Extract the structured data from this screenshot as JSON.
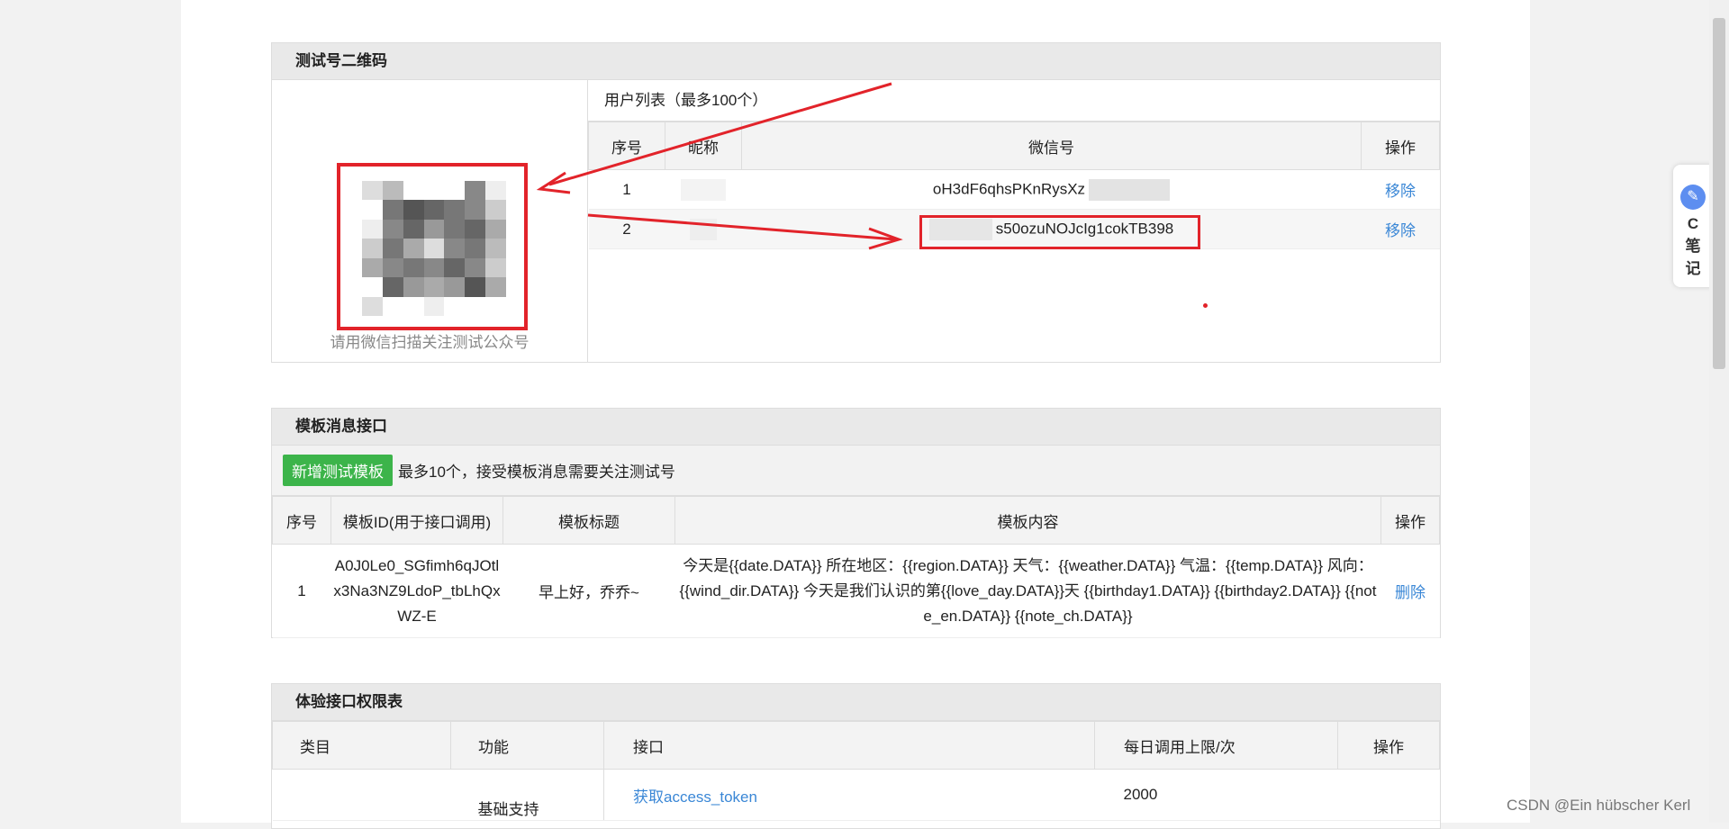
{
  "qr_panel": {
    "title": "测试号二维码",
    "caption": "请用微信扫描关注测试公众号",
    "users_title": "用户列表（最多100个）",
    "columns": [
      "序号",
      "昵称",
      "微信号",
      "操作"
    ],
    "rows": [
      {
        "index": "1",
        "openid_visible": "oH3dF6qhsPKnRysXz",
        "action": "移除"
      },
      {
        "index": "2",
        "openid_visible": "s50ozuNOJcIg1cokTB398",
        "action": "移除"
      }
    ]
  },
  "template_panel": {
    "title": "模板消息接口",
    "add_button": "新增测试模板",
    "hint": "最多10个，接受模板消息需要关注测试号",
    "columns": [
      "序号",
      "模板ID(用于接口调用)",
      "模板标题",
      "模板内容",
      "操作"
    ],
    "rows": [
      {
        "index": "1",
        "template_id": "A0J0Le0_SGfimh6qJOtlx3Na3NZ9LdoP_tbLhQxWZ-E",
        "title": "早上好，乔乔~",
        "content": "今天是{{date.DATA}} 所在地区：{{region.DATA}} 天气：{{weather.DATA}} 气温：{{temp.DATA}} 风向：{{wind_dir.DATA}} 今天是我们认识的第{{love_day.DATA}}天 {{birthday1.DATA}} {{birthday2.DATA}} {{note_en.DATA}} {{note_ch.DATA}}",
        "action": "删除"
      }
    ]
  },
  "perm_panel": {
    "title": "体验接口权限表",
    "columns": [
      "类目",
      "功能",
      "接口",
      "每日调用上限/次",
      "操作"
    ],
    "rows": [
      {
        "category": "",
        "function": "基础支持",
        "api": "获取access_token",
        "limit": "2000"
      }
    ]
  },
  "side_tab": {
    "line1": "C",
    "line2": "笔",
    "line3": "记"
  },
  "watermark": "CSDN @Ein hübscher Kerl",
  "colors": {
    "accent_red": "#e2232a",
    "link_blue": "#3a87d6",
    "button_green": "#3cb44a"
  }
}
